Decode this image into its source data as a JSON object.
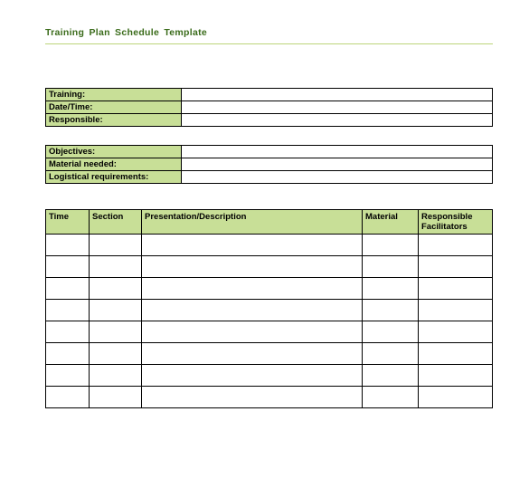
{
  "title": "Training Plan  Schedule  Template",
  "info1": {
    "rows": [
      {
        "label": "Training:",
        "value": ""
      },
      {
        "label": "Date/Time:",
        "value": ""
      },
      {
        "label": "Responsible:",
        "value": ""
      }
    ]
  },
  "info2": {
    "rows": [
      {
        "label": "Objectives:",
        "value": ""
      },
      {
        "label": "Material needed:",
        "value": ""
      },
      {
        "label": "Logistical requirements:",
        "value": ""
      }
    ]
  },
  "schedule": {
    "headers": {
      "time": "Time",
      "section": "Section",
      "presentation": "Presentation/Description",
      "material": "Material",
      "responsible": "Responsible Facilitators"
    },
    "rows": [
      {
        "time": "",
        "section": "",
        "presentation": "",
        "material": "",
        "responsible": ""
      },
      {
        "time": "",
        "section": "",
        "presentation": "",
        "material": "",
        "responsible": ""
      },
      {
        "time": "",
        "section": "",
        "presentation": "",
        "material": "",
        "responsible": ""
      },
      {
        "time": "",
        "section": "",
        "presentation": "",
        "material": "",
        "responsible": ""
      },
      {
        "time": "",
        "section": "",
        "presentation": "",
        "material": "",
        "responsible": ""
      },
      {
        "time": "",
        "section": "",
        "presentation": "",
        "material": "",
        "responsible": ""
      },
      {
        "time": "",
        "section": "",
        "presentation": "",
        "material": "",
        "responsible": ""
      },
      {
        "time": "",
        "section": "",
        "presentation": "",
        "material": "",
        "responsible": ""
      }
    ]
  }
}
